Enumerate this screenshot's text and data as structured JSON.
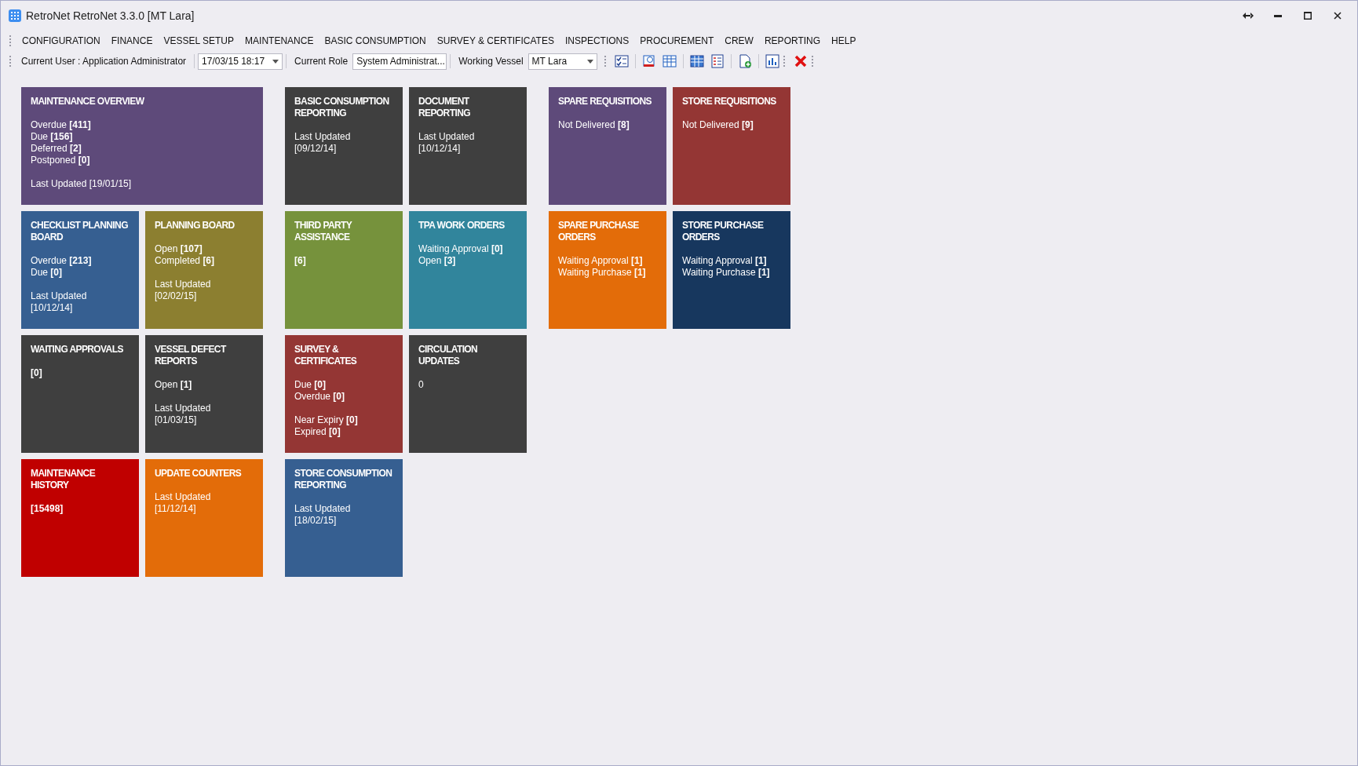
{
  "window": {
    "title": "RetroNet RetroNet 3.3.0 [MT Lara]"
  },
  "menu": [
    "CONFIGURATION",
    "FINANCE",
    "VESSEL SETUP",
    "MAINTENANCE",
    "BASIC CONSUMPTION",
    "SURVEY & CERTIFICATES",
    "INSPECTIONS",
    "PROCUREMENT",
    "CREW",
    "REPORTING",
    "HELP"
  ],
  "toolbar": {
    "user_label": "Current User : Application Administrator",
    "date": "17/03/15 18:17",
    "role_label": "Current Role",
    "role": "System Administrat...",
    "vessel_label": "Working Vessel",
    "vessel": "MT Lara"
  },
  "groups": [
    {
      "tiles": [
        {
          "title": "MAINTENANCE OVERVIEW",
          "color": "#5e4a7a",
          "wide": true,
          "sections": [
            [
              "Overdue **[411]**",
              "Due **[156]**",
              "Deferred **[2]**",
              "Postponed **[0]**"
            ],
            [
              "Last Updated [19/01/15]"
            ]
          ]
        },
        {
          "title": "CHECKLIST PLANNING BOARD",
          "color": "#365f91",
          "wide": false,
          "sections": [
            [
              "Overdue **[213]**",
              "Due **[0]**"
            ],
            [
              "Last Updated",
              "[10/12/14]"
            ]
          ]
        },
        {
          "title": "PLANNING BOARD",
          "color": "#8c7f30",
          "wide": false,
          "sections": [
            [
              "Open **[107]**",
              "Completed **[6]**"
            ],
            [
              "Last Updated",
              "[02/02/15]"
            ]
          ]
        },
        {
          "title": "WAITING APPROVALS",
          "color": "#3f3f3f",
          "wide": false,
          "sections": [
            [
              "**[0]**"
            ]
          ]
        },
        {
          "title": "VESSEL DEFECT REPORTS",
          "color": "#3f3f3f",
          "wide": false,
          "sections": [
            [
              "Open **[1]**"
            ],
            [
              "Last Updated",
              "[01/03/15]"
            ]
          ]
        },
        {
          "title": "MAINTENANCE HISTORY",
          "color": "#c00000",
          "wide": false,
          "sections": [
            [
              "**[15498]**"
            ]
          ]
        },
        {
          "title": "UPDATE COUNTERS",
          "color": "#e36c09",
          "wide": false,
          "sections": [
            [
              "Last Updated",
              "[11/12/14]"
            ]
          ]
        }
      ]
    },
    {
      "tiles": [
        {
          "title": "BASIC CONSUMPTION REPORTING",
          "color": "#3f3f3f",
          "wide": false,
          "sections": [
            [
              "Last Updated",
              "[09/12/14]"
            ]
          ]
        },
        {
          "title": "DOCUMENT REPORTING",
          "color": "#3f3f3f",
          "wide": false,
          "sections": [
            [
              "Last Updated",
              "[10/12/14]"
            ]
          ]
        },
        {
          "title": "THIRD PARTY ASSISTANCE",
          "color": "#76923c",
          "wide": false,
          "sections": [
            [
              "**[6]**"
            ]
          ]
        },
        {
          "title": "TPA WORK ORDERS",
          "color": "#31859c",
          "wide": false,
          "sections": [
            [
              "Waiting Approval **[0]**",
              "Open **[3]**"
            ]
          ]
        },
        {
          "title": "SURVEY & CERTIFICATES",
          "color": "#943634",
          "wide": false,
          "sections": [
            [
              "Due **[0]**",
              "Overdue **[0]**"
            ],
            [
              "Near Expiry **[0]**",
              "Expired **[0]**"
            ]
          ]
        },
        {
          "title": "CIRCULATION UPDATES",
          "color": "#3f3f3f",
          "wide": false,
          "sections": [
            [
              "0"
            ]
          ]
        },
        {
          "title": "STORE CONSUMPTION REPORTING",
          "color": "#365f91",
          "wide": false,
          "sections": [
            [
              "Last Updated",
              "[18/02/15]"
            ]
          ]
        }
      ]
    },
    {
      "tiles": [
        {
          "title": "SPARE REQUISITIONS",
          "color": "#5e4a7a",
          "wide": false,
          "sections": [
            [
              "Not Delivered **[8]**"
            ]
          ]
        },
        {
          "title": "STORE REQUISITIONS",
          "color": "#943634",
          "wide": false,
          "sections": [
            [
              "Not Delivered **[9]**"
            ]
          ]
        },
        {
          "title": "SPARE PURCHASE ORDERS",
          "color": "#e36c09",
          "wide": false,
          "sections": [
            [
              "Waiting Approval **[1]**",
              "Waiting Purchase **[1]**"
            ]
          ]
        },
        {
          "title": "STORE PURCHASE ORDERS",
          "color": "#17375e",
          "wide": false,
          "sections": [
            [
              "Waiting Approval **[1]**",
              "Waiting Purchase **[1]**"
            ]
          ]
        }
      ]
    }
  ]
}
